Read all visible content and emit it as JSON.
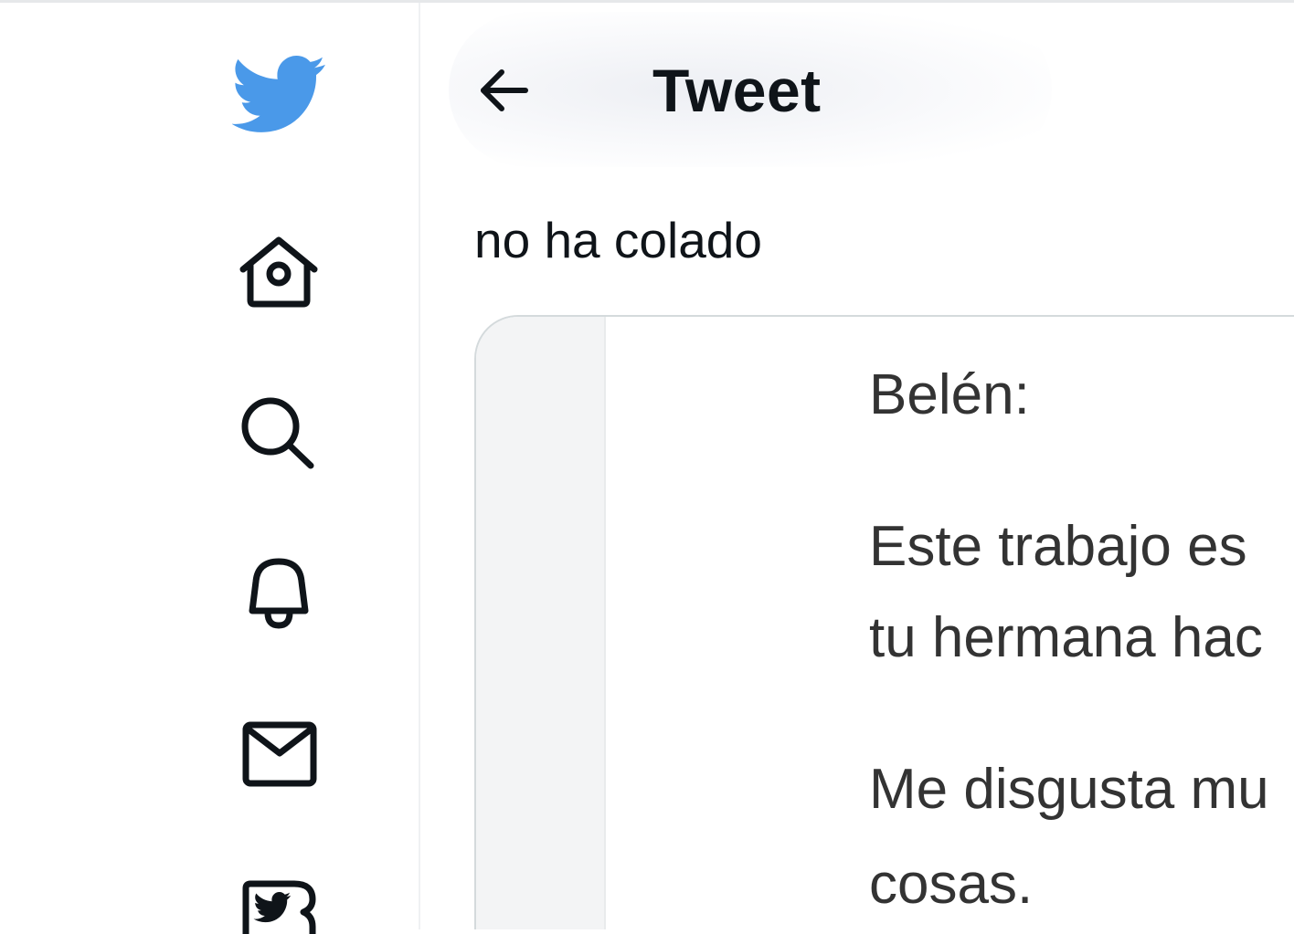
{
  "sidebar": {
    "items": [
      {
        "name": "twitter-logo-icon",
        "label": "Twitter"
      },
      {
        "name": "home-icon",
        "label": "Home"
      },
      {
        "name": "search-icon",
        "label": "Explore"
      },
      {
        "name": "bell-icon",
        "label": "Notifications"
      },
      {
        "name": "mail-icon",
        "label": "Messages"
      },
      {
        "name": "twitter-blue-icon",
        "label": "Twitter Blue"
      }
    ],
    "brand_color": "#4a99e9"
  },
  "header": {
    "back_label": "Back",
    "title": "Tweet"
  },
  "tweet": {
    "text": "no ha colado",
    "media": {
      "lines": [
        "Belén:",
        "Este trabajo es",
        "tu hermana hac",
        "Me disgusta mu",
        "cosas."
      ]
    }
  }
}
